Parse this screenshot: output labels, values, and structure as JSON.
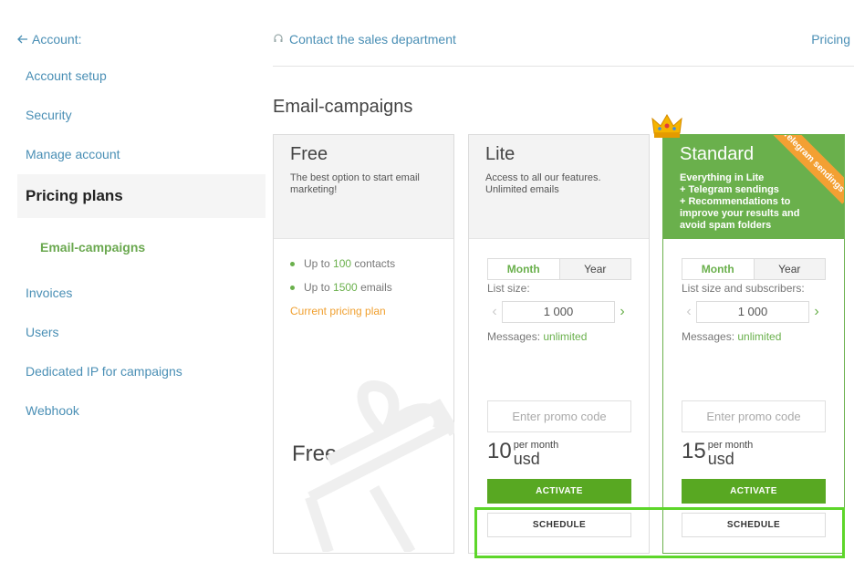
{
  "sidebar": {
    "back_label": "Account:",
    "items": [
      {
        "label": "Account setup"
      },
      {
        "label": "Security"
      },
      {
        "label": "Manage account"
      },
      {
        "label": "Pricing plans"
      },
      {
        "label": "Email-campaigns"
      },
      {
        "label": "Invoices"
      },
      {
        "label": "Users"
      },
      {
        "label": "Dedicated IP for campaigns"
      },
      {
        "label": "Webhook"
      }
    ]
  },
  "header": {
    "contact_label": "Contact the sales department",
    "pricing_label": "Pricing"
  },
  "section_title": "Email-campaigns",
  "plans": {
    "free": {
      "title": "Free",
      "description": "The best option to start email marketing!",
      "feature1_pre": "Up to ",
      "feature1_value": "100",
      "feature1_post": " contacts",
      "feature2_pre": "Up to ",
      "feature2_value": "1500",
      "feature2_post": " emails",
      "current_label": "Current pricing plan",
      "price_label": "Free"
    },
    "lite": {
      "title": "Lite",
      "description": "Access to all our features. Unlimited emails",
      "toggle_month": "Month",
      "toggle_year": "Year",
      "list_label": "List size:",
      "list_value": "1 000",
      "messages_label": "Messages: ",
      "messages_value": "unlimited",
      "promo_placeholder": "Enter promo code",
      "price": "10",
      "per_month": "per month",
      "currency": "usd",
      "activate_label": "ACTIVATE",
      "schedule_label": "SCHEDULE"
    },
    "standard": {
      "title": "Standard",
      "description": "Everything in Lite\n+ Telegram sendings\n+ Recommendations to improve your results and avoid spam folders",
      "ribbon": "Telegram sendings",
      "toggle_month": "Month",
      "toggle_year": "Year",
      "list_label": "List size and subscribers:",
      "list_value": "1 000",
      "messages_label": "Messages: ",
      "messages_value": "unlimited",
      "promo_placeholder": "Enter promo code",
      "price": "15",
      "per_month": "per month",
      "currency": "usd",
      "activate_label": "ACTIVATE",
      "schedule_label": "SCHEDULE"
    }
  },
  "colors": {
    "accent_green": "#6ab04c",
    "button_green": "#58a822",
    "link_blue": "#4a8fb5",
    "current_plan_orange": "#f0a030",
    "highlight": "#5dd62a"
  }
}
